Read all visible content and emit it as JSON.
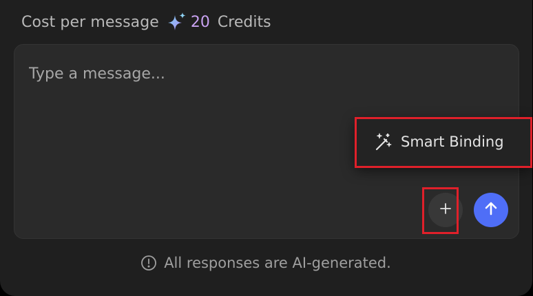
{
  "cost": {
    "label": "Cost per message",
    "icon": "sparkle-icon",
    "amount": "20",
    "unit": "Credits"
  },
  "composer": {
    "placeholder": "Type a message..."
  },
  "popover": {
    "icon": "magic-wand-icon",
    "label": "Smart Binding"
  },
  "actions": {
    "attach_icon": "plus-icon",
    "send_icon": "arrow-up-icon"
  },
  "footer": {
    "icon": "info-icon",
    "text": "All responses are AI-generated."
  },
  "colors": {
    "background": "#1f1f1f",
    "composer": "#2a2a2a",
    "credits_accent": "#c9a2f2",
    "send_button": "#4f6ef7",
    "highlight": "#e0202a"
  }
}
